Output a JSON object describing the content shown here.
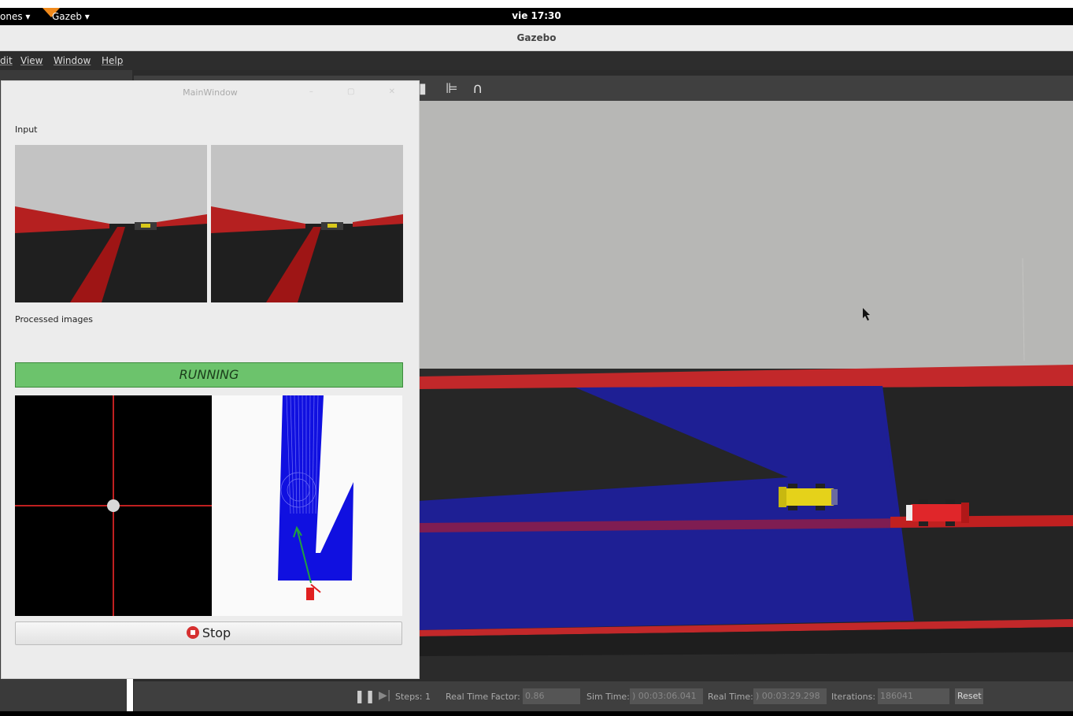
{
  "top_panel": {
    "left_menu": "ones ▾",
    "app_menu": "Gazeb ▾",
    "clock": "vie 17:30"
  },
  "window": {
    "title": "Gazebo"
  },
  "menubar": {
    "items": [
      "dit",
      "View",
      "Window",
      "Help"
    ]
  },
  "toolbar": {
    "icons": [
      "copy-icon",
      "align-icon",
      "magnet-icon"
    ]
  },
  "main_window": {
    "title": "MainWindow",
    "input_label": "Input",
    "processed_label": "Processed images",
    "status_text": "RUNNING",
    "stop_label": "Stop",
    "status_color": "#6cc36c"
  },
  "bottom_bar": {
    "steps_label": "Steps:",
    "steps_value": "1",
    "rtf_label": "Real Time Factor:",
    "rtf_value": "0.86",
    "sim_time_label": "Sim Time:",
    "sim_time_value": ") 00:03:06.041",
    "real_time_label": "Real Time:",
    "real_time_value": ") 00:03:29.298",
    "iterations_label": "Iterations:",
    "iterations_value": "186041",
    "reset_label": "Reset"
  }
}
